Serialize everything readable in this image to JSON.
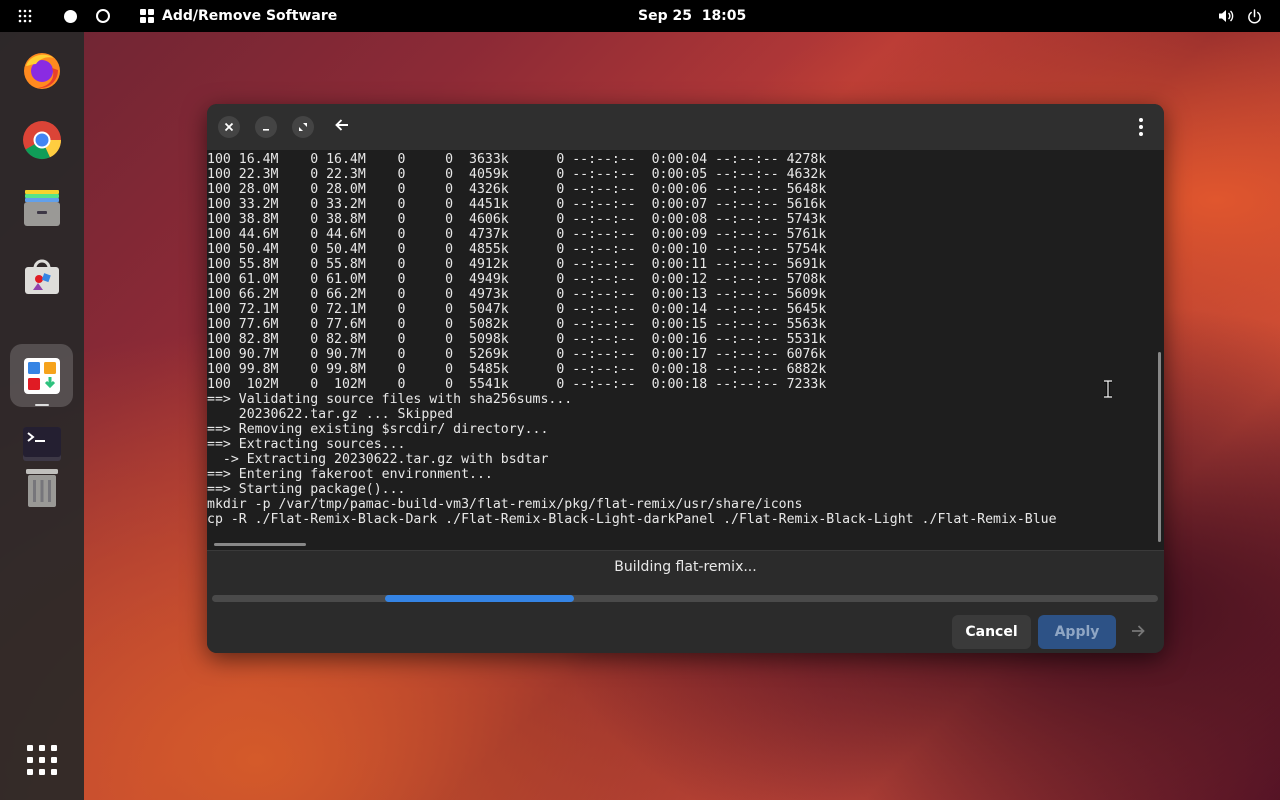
{
  "topbar": {
    "app_title": "Add/Remove Software",
    "clock": "Sep 25  18:05",
    "icons": [
      "apps-grid-icon",
      "workspace-dot-icon",
      "workspace-ring-icon",
      "software-app-icon",
      "volume-icon",
      "power-icon"
    ]
  },
  "dash": {
    "apps": [
      "firefox-icon",
      "chrome-icon",
      "files-icon",
      "software-store-icon",
      "add-remove-software-icon",
      "terminal-icon",
      "trash-icon",
      "show-apps-icon"
    ]
  },
  "window": {
    "controls": [
      "close-icon",
      "minimize-icon",
      "restore-icon",
      "back-arrow-icon",
      "kebab-menu-icon"
    ],
    "terminal_lines": [
      "100 16.4M    0 16.4M    0     0  3633k      0 --:--:--  0:00:04 --:--:-- 4278k",
      "100 22.3M    0 22.3M    0     0  4059k      0 --:--:--  0:00:05 --:--:-- 4632k",
      "100 28.0M    0 28.0M    0     0  4326k      0 --:--:--  0:00:06 --:--:-- 5648k",
      "100 33.2M    0 33.2M    0     0  4451k      0 --:--:--  0:00:07 --:--:-- 5616k",
      "100 38.8M    0 38.8M    0     0  4606k      0 --:--:--  0:00:08 --:--:-- 5743k",
      "100 44.6M    0 44.6M    0     0  4737k      0 --:--:--  0:00:09 --:--:-- 5761k",
      "100 50.4M    0 50.4M    0     0  4855k      0 --:--:--  0:00:10 --:--:-- 5754k",
      "100 55.8M    0 55.8M    0     0  4912k      0 --:--:--  0:00:11 --:--:-- 5691k",
      "100 61.0M    0 61.0M    0     0  4949k      0 --:--:--  0:00:12 --:--:-- 5708k",
      "100 66.2M    0 66.2M    0     0  4973k      0 --:--:--  0:00:13 --:--:-- 5609k",
      "100 72.1M    0 72.1M    0     0  5047k      0 --:--:--  0:00:14 --:--:-- 5645k",
      "100 77.6M    0 77.6M    0     0  5082k      0 --:--:--  0:00:15 --:--:-- 5563k",
      "100 82.8M    0 82.8M    0     0  5098k      0 --:--:--  0:00:16 --:--:-- 5531k",
      "100 90.7M    0 90.7M    0     0  5269k      0 --:--:--  0:00:17 --:--:-- 6076k",
      "100 99.8M    0 99.8M    0     0  5485k      0 --:--:--  0:00:18 --:--:-- 6882k",
      "100  102M    0  102M    0     0  5541k      0 --:--:--  0:00:18 --:--:-- 7233k",
      "==> Validating source files with sha256sums...",
      "    20230622.tar.gz ... Skipped",
      "==> Removing existing $srcdir/ directory...",
      "==> Extracting sources...",
      "  -> Extracting 20230622.tar.gz with bsdtar",
      "==> Entering fakeroot environment...",
      "==> Starting package()...",
      "mkdir -p /var/tmp/pamac-build-vm3/flat-remix/pkg/flat-remix/usr/share/icons",
      "cp -R ./Flat-Remix-Black-Dark ./Flat-Remix-Black-Light-darkPanel ./Flat-Remix-Black-Light ./Flat-Remix-Blue"
    ],
    "status_text": "Building flat-remix...",
    "progress_note": "indeterminate pulse bar",
    "cancel_label": "Cancel",
    "apply_label": "Apply",
    "next_icon": "arrow-right-icon"
  },
  "colors": {
    "accent": "#3584e4",
    "apply_bg": "#2d5286",
    "window_bg": "#2b2b2b",
    "terminal_bg": "#1e1e1e"
  }
}
